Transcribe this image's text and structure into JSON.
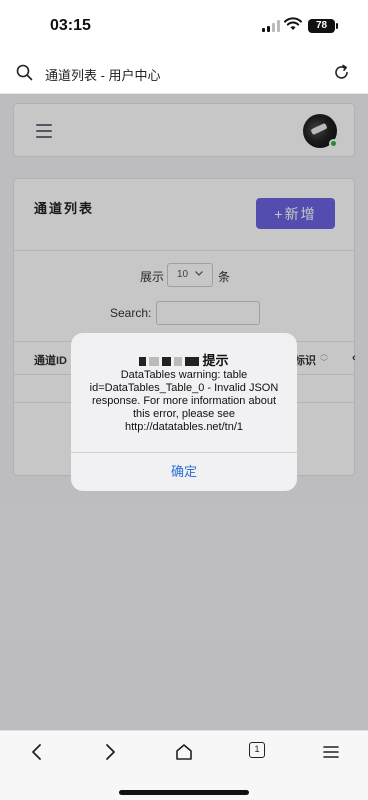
{
  "status_bar": {
    "time": "03:15",
    "battery": "78"
  },
  "address_bar": {
    "title": "通道列表 - 用户中心",
    "search_icon": "search-icon",
    "reload_icon": "reload-icon"
  },
  "topbar": {
    "menu_icon": "hamburger-icon"
  },
  "card": {
    "title": "通道列表",
    "add_button": "+新增",
    "length_label": "展示",
    "length_value": "10",
    "length_suffix": "条",
    "search_label": "Search:",
    "columns": [
      "通道ID",
      "标识"
    ],
    "truncated_column": "‹"
  },
  "modal": {
    "title_suffix": "提示",
    "message": "DataTables warning: table id=DataTables_Table_0 - Invalid JSON response. For more information about this error, please see http://datatables.net/tn/1",
    "ok_label": "确定"
  },
  "bottom_bar": {
    "tabs_count": "1"
  },
  "colors": {
    "accent": "#6a63e0",
    "link": "#2a6fd6",
    "online": "#2fb344"
  }
}
